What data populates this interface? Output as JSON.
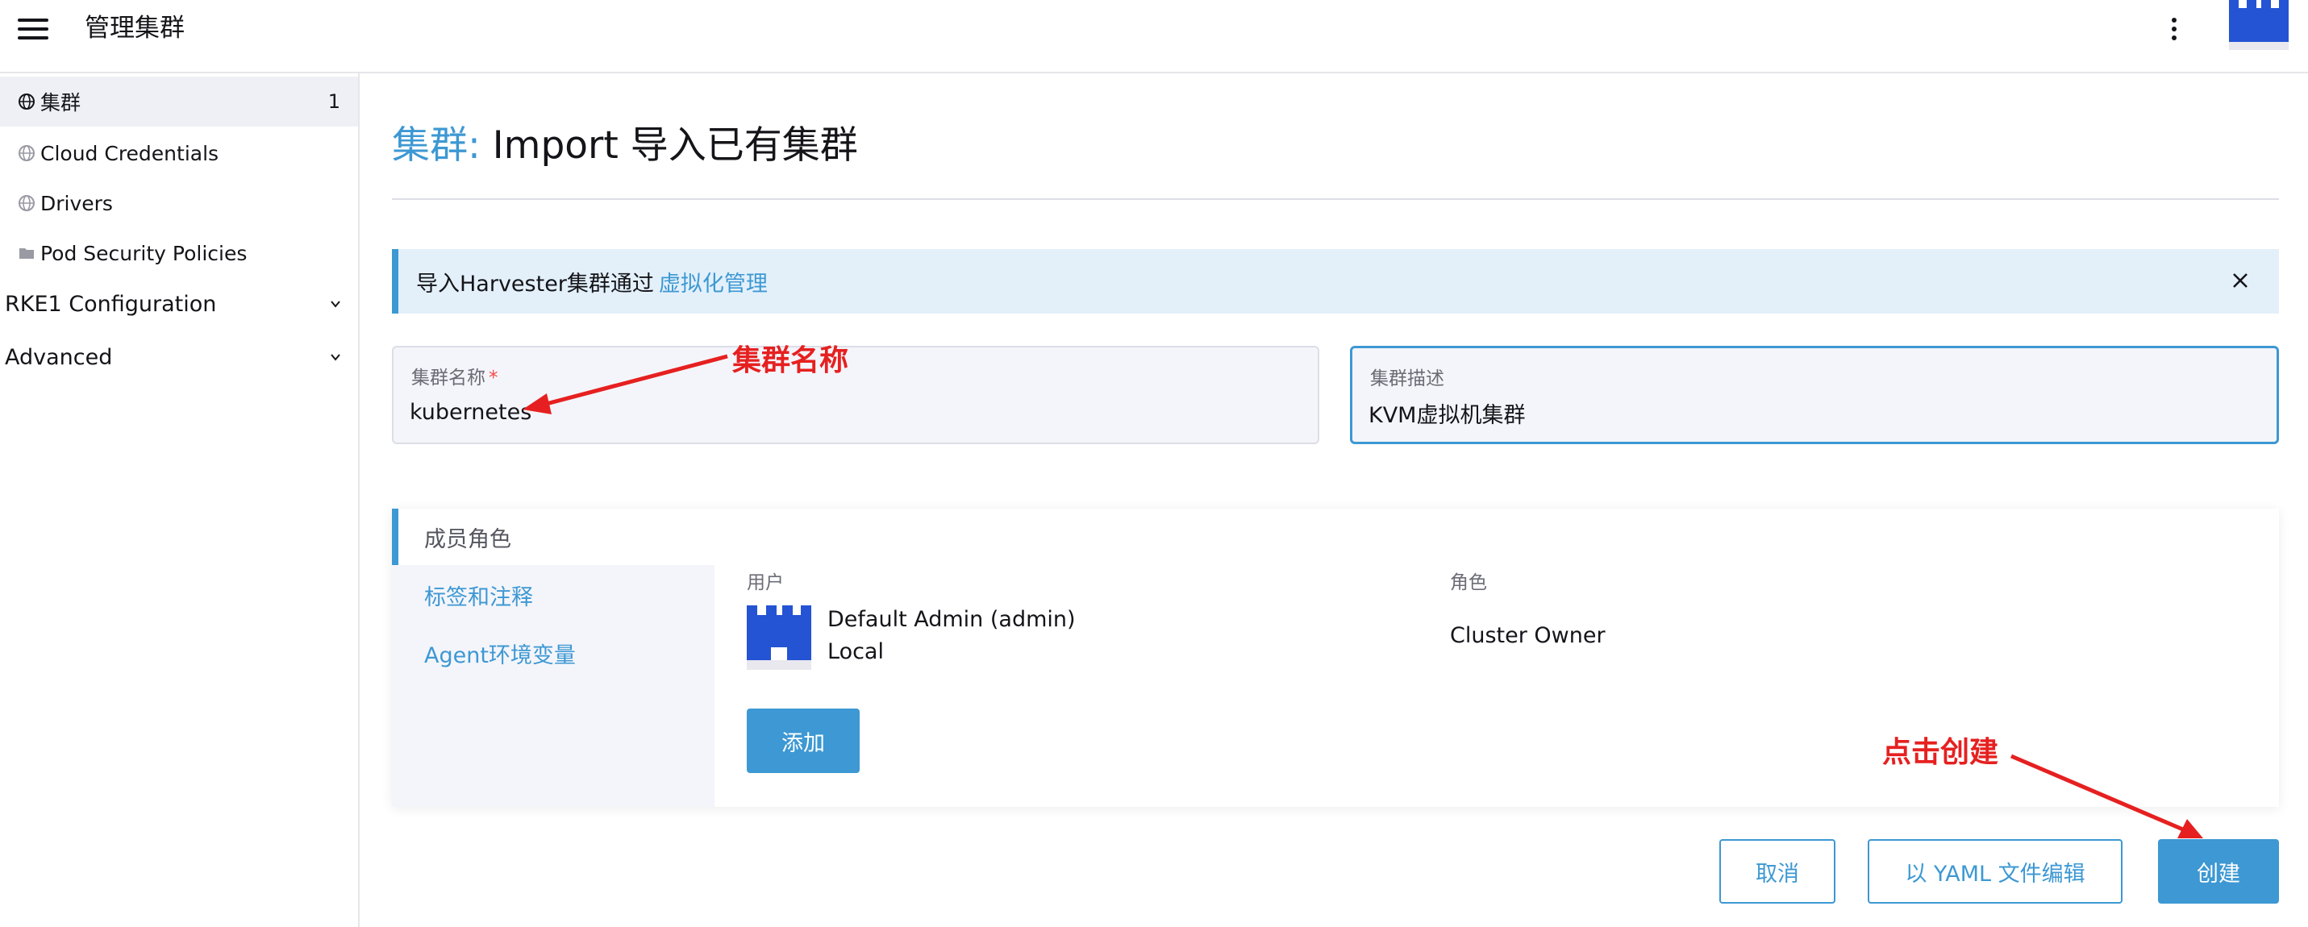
{
  "header": {
    "title": "管理集群",
    "menu_icon": "hamburger-menu-icon",
    "more_icon": "kebab-menu-icon"
  },
  "sidebar": {
    "items": [
      {
        "label": "集群",
        "count": "1",
        "icon": "globe-icon",
        "active": true
      },
      {
        "label": "Cloud Credentials",
        "icon": "globe-icon"
      },
      {
        "label": "Drivers",
        "icon": "globe-icon"
      },
      {
        "label": "Pod Security Policies",
        "icon": "folder-icon"
      }
    ],
    "groups": [
      {
        "label": "RKE1 Configuration"
      },
      {
        "label": "Advanced"
      }
    ]
  },
  "page": {
    "crumb": "集群:",
    "title": "Import 导入已有集群"
  },
  "banner": {
    "text": "导入Harvester集群通过",
    "link": "虚拟化管理"
  },
  "form": {
    "name_label": "集群名称",
    "name_required_mark": "*",
    "name_value": "kubernetes",
    "desc_label": "集群描述",
    "desc_value": "KVM虚拟机集群"
  },
  "tabs": [
    {
      "label": "成员角色",
      "active": true
    },
    {
      "label": "标签和注释"
    },
    {
      "label": "Agent环境变量"
    }
  ],
  "members": {
    "user_header": "用户",
    "role_header": "角色",
    "rows": [
      {
        "name": "Default Admin (admin)",
        "provider": "Local",
        "role": "Cluster Owner"
      }
    ],
    "add_label": "添加"
  },
  "actions": {
    "cancel": "取消",
    "yaml": "以 YAML 文件编辑",
    "create": "创建"
  },
  "annotations": {
    "name_note": "集群名称",
    "create_note": "点击创建"
  },
  "colors": {
    "accent": "#3d98d3",
    "annotation": "#e62020",
    "banner_bg": "#e3f0fa"
  }
}
